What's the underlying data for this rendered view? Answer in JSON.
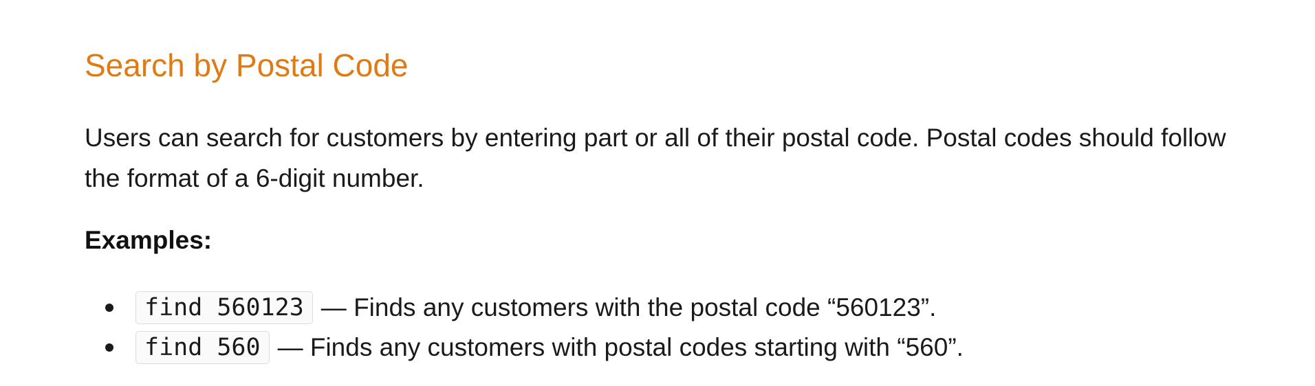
{
  "section": {
    "title": "Search by Postal Code",
    "description": "Users can search for customers by entering part or all of their postal code. Postal codes should follow the format of a 6-digit number.",
    "examples_label": "Examples:",
    "examples": [
      {
        "command": "find 560123",
        "description": "— Finds any customers with the postal code “560123”."
      },
      {
        "command": "find 560",
        "description": "— Finds any customers with postal codes starting with “560”."
      }
    ]
  },
  "colors": {
    "heading": "#e07a14",
    "text": "#1a1a1a",
    "code_border": "#dcdcdc"
  }
}
